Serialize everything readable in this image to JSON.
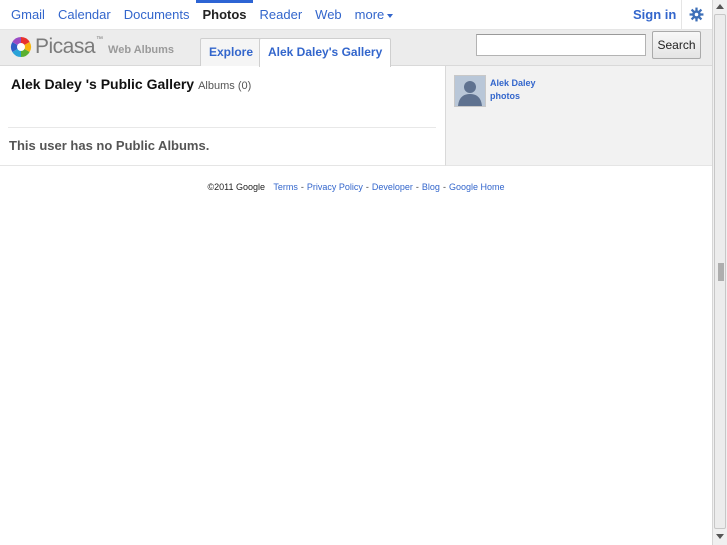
{
  "topnav": {
    "items": [
      {
        "label": "Gmail",
        "active": false
      },
      {
        "label": "Calendar",
        "active": false
      },
      {
        "label": "Documents",
        "active": false
      },
      {
        "label": "Photos",
        "active": true
      },
      {
        "label": "Reader",
        "active": false
      },
      {
        "label": "Web",
        "active": false
      }
    ],
    "more_label": "more",
    "signin_label": "Sign in",
    "settings_icon": "gear-icon"
  },
  "header": {
    "logo_word": "Picasa",
    "logo_tm": "™",
    "logo_sub": "Web Albums",
    "tabs": [
      {
        "label": "Explore",
        "selected": false
      },
      {
        "label": "Alek Daley's Gallery",
        "selected": true
      }
    ],
    "search": {
      "value": "",
      "placeholder": ""
    },
    "search_button": "Search"
  },
  "main": {
    "gallery_title": "Alek Daley 's Public Gallery",
    "albums_label": "Albums (0)",
    "empty_message": "This user has no Public Albums."
  },
  "sidebar": {
    "user_name": "Alek Daley",
    "photos_link": "photos",
    "avatar_icon": "user-silhouette-icon"
  },
  "footer": {
    "copyright": "©2011 Google",
    "links": [
      "Terms",
      "Privacy Policy",
      "Developer",
      "Blog",
      "Google Home"
    ],
    "separator": "-"
  },
  "colors": {
    "link": "#3366cc",
    "active_bar": "#2d64d4",
    "header_bg": "#ececec"
  }
}
